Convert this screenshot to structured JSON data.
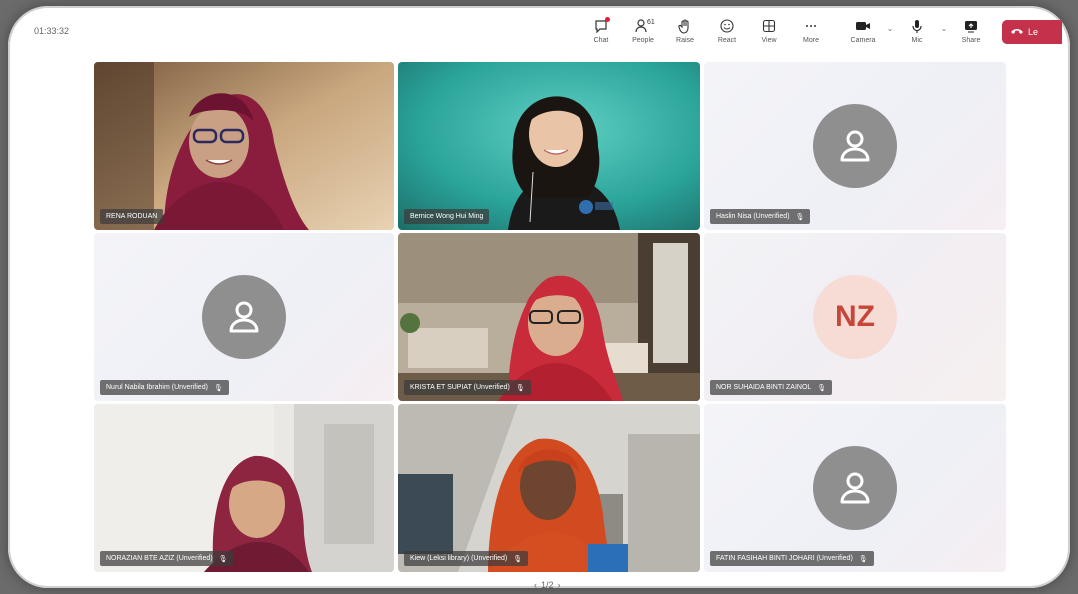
{
  "meeting": {
    "timer": "01:33:32"
  },
  "toolbar": {
    "chat": "Chat",
    "people": "People",
    "people_count": "61",
    "raise": "Raise",
    "react": "React",
    "view": "View",
    "more": "More",
    "camera": "Camera",
    "mic": "Mic",
    "share": "Share",
    "leave": "Le"
  },
  "participants": [
    {
      "name": "RENA RODUAN",
      "video": true
    },
    {
      "name": "Bernice Wong Hui Ming",
      "video": true
    },
    {
      "name": "Haslin Nisa (Unverified)",
      "video": false,
      "avatar": "person-icon"
    },
    {
      "name": "Nurul Nabila Ibrahim (Unverified)",
      "video": false,
      "avatar": "person-icon"
    },
    {
      "name": "KRISTA ET SUPIAT (Unverified)",
      "video": true
    },
    {
      "name": "NOR SUHAIDA BINTI ZAINOL",
      "video": false,
      "initials": "NZ"
    },
    {
      "name": "NORAZIAN BTE AZIZ (Unverified)",
      "video": true
    },
    {
      "name": "Kiew (Leksi library) (Unverified)",
      "video": true
    },
    {
      "name": "FATIN FASIHAH BINTI JOHARI (Unverified)",
      "video": false,
      "avatar": "person-icon"
    }
  ],
  "pagination": {
    "label": "1/2"
  },
  "colors": {
    "leave": "#c4314b",
    "initials_bg": "#f7dcd6",
    "initials_text": "#c6463a",
    "avatar_bg": "#8f8f8f"
  }
}
